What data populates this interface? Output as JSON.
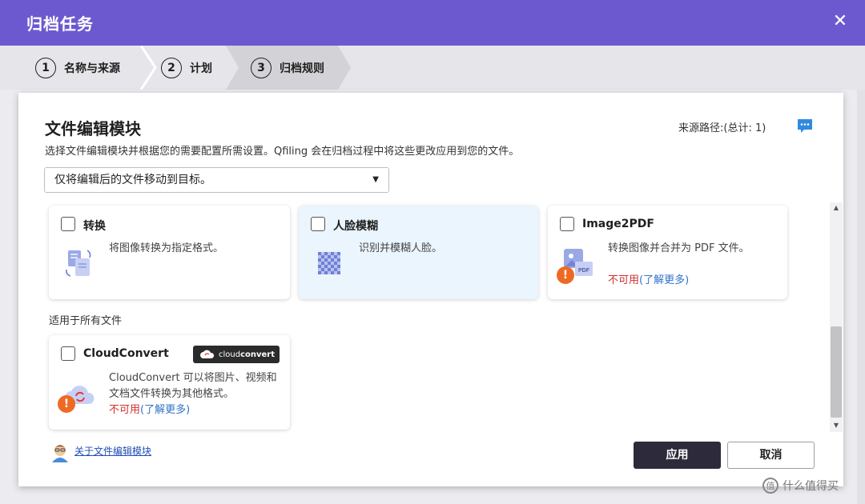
{
  "window": {
    "title": "归档任务"
  },
  "steps": [
    {
      "num": "1",
      "label": "名称与来源"
    },
    {
      "num": "2",
      "label": "计划"
    },
    {
      "num": "3",
      "label": "归档规则"
    }
  ],
  "panel": {
    "title": "文件编辑模块",
    "description": "选择文件编辑模块并根据您的需要配置所需设置。Qfiling 会在归档过程中将这些更改应用到您的文件。",
    "source_path": "来源路径:(总计: 1)",
    "select": {
      "value": "仅将编辑后的文件移动到目标。"
    }
  },
  "modules": [
    {
      "title": "转换",
      "desc": "将图像转换为指定格式。",
      "icon": "convert-icon",
      "highlighted": false
    },
    {
      "title": "人脸模糊",
      "desc": "识别并模糊人脸。",
      "icon": "face-blur-icon",
      "highlighted": true
    },
    {
      "title": "Image2PDF",
      "desc": "转换图像并合并为 PDF 文件。",
      "unavailable": "不可用",
      "learn_more": "(了解更多)",
      "icon": "image2pdf-icon",
      "highlighted": false
    }
  ],
  "section_all_files": "适用于所有文件",
  "cloudconvert": {
    "title": "CloudConvert",
    "brand_a": "cloud",
    "brand_b": "convert",
    "desc_line1": "CloudConvert 可以将图片、视频和",
    "desc_line2": "文档文件转换为其他格式。",
    "unavailable": "不可用",
    "learn_more": "(了解更多)"
  },
  "about_link": "关于文件编辑模块",
  "buttons": {
    "apply": "应用",
    "cancel": "取消"
  },
  "watermark": {
    "glyph": "值",
    "text": "什么值得买"
  },
  "colors": {
    "titlebar": "#6d59cf",
    "primary_button": "#2c2a3b",
    "warning": "#ee6a24",
    "link": "#2f73c9",
    "unavailable": "#d32f2f"
  }
}
